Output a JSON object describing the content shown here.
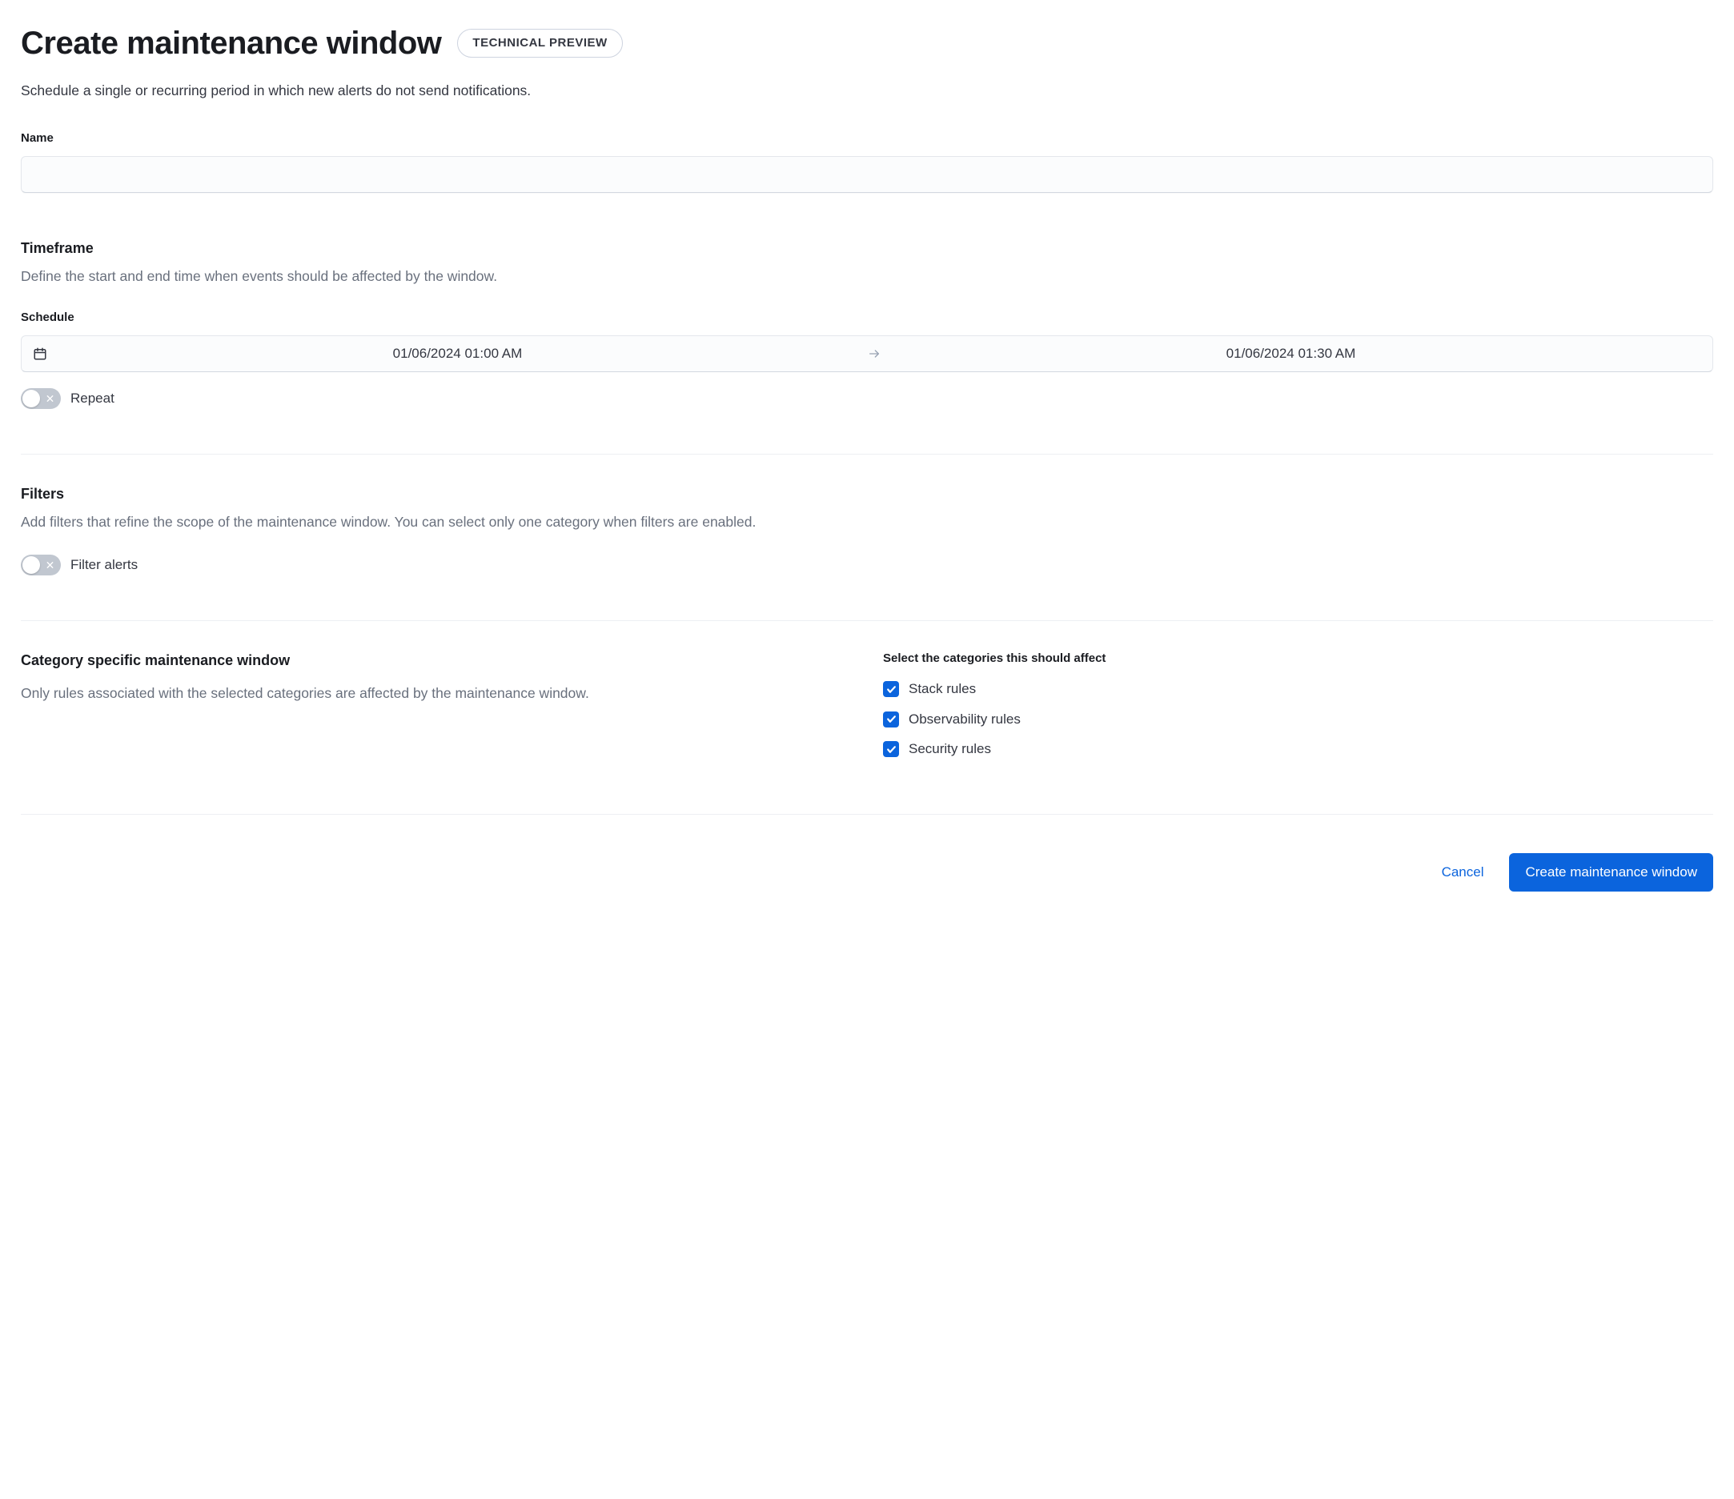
{
  "header": {
    "title": "Create maintenance window",
    "badge": "TECHNICAL PREVIEW",
    "subtitle": "Schedule a single or recurring period in which new alerts do not send notifications."
  },
  "name_field": {
    "label": "Name",
    "value": ""
  },
  "timeframe": {
    "title": "Timeframe",
    "description": "Define the start and end time when events should be affected by the window.",
    "schedule_label": "Schedule",
    "start": "01/06/2024 01:00 AM",
    "end": "01/06/2024 01:30 AM",
    "repeat_label": "Repeat",
    "repeat_on": false
  },
  "filters": {
    "title": "Filters",
    "description": "Add filters that refine the scope of the maintenance window. You can select only one category when filters are enabled.",
    "toggle_label": "Filter alerts",
    "toggle_on": false
  },
  "categories": {
    "title": "Category specific maintenance window",
    "description": "Only rules associated with the selected categories are affected by the maintenance window.",
    "select_heading": "Select the categories this should affect",
    "items": [
      {
        "label": "Stack rules",
        "checked": true
      },
      {
        "label": "Observability rules",
        "checked": true
      },
      {
        "label": "Security rules",
        "checked": true
      }
    ]
  },
  "footer": {
    "cancel": "Cancel",
    "submit": "Create maintenance window"
  }
}
